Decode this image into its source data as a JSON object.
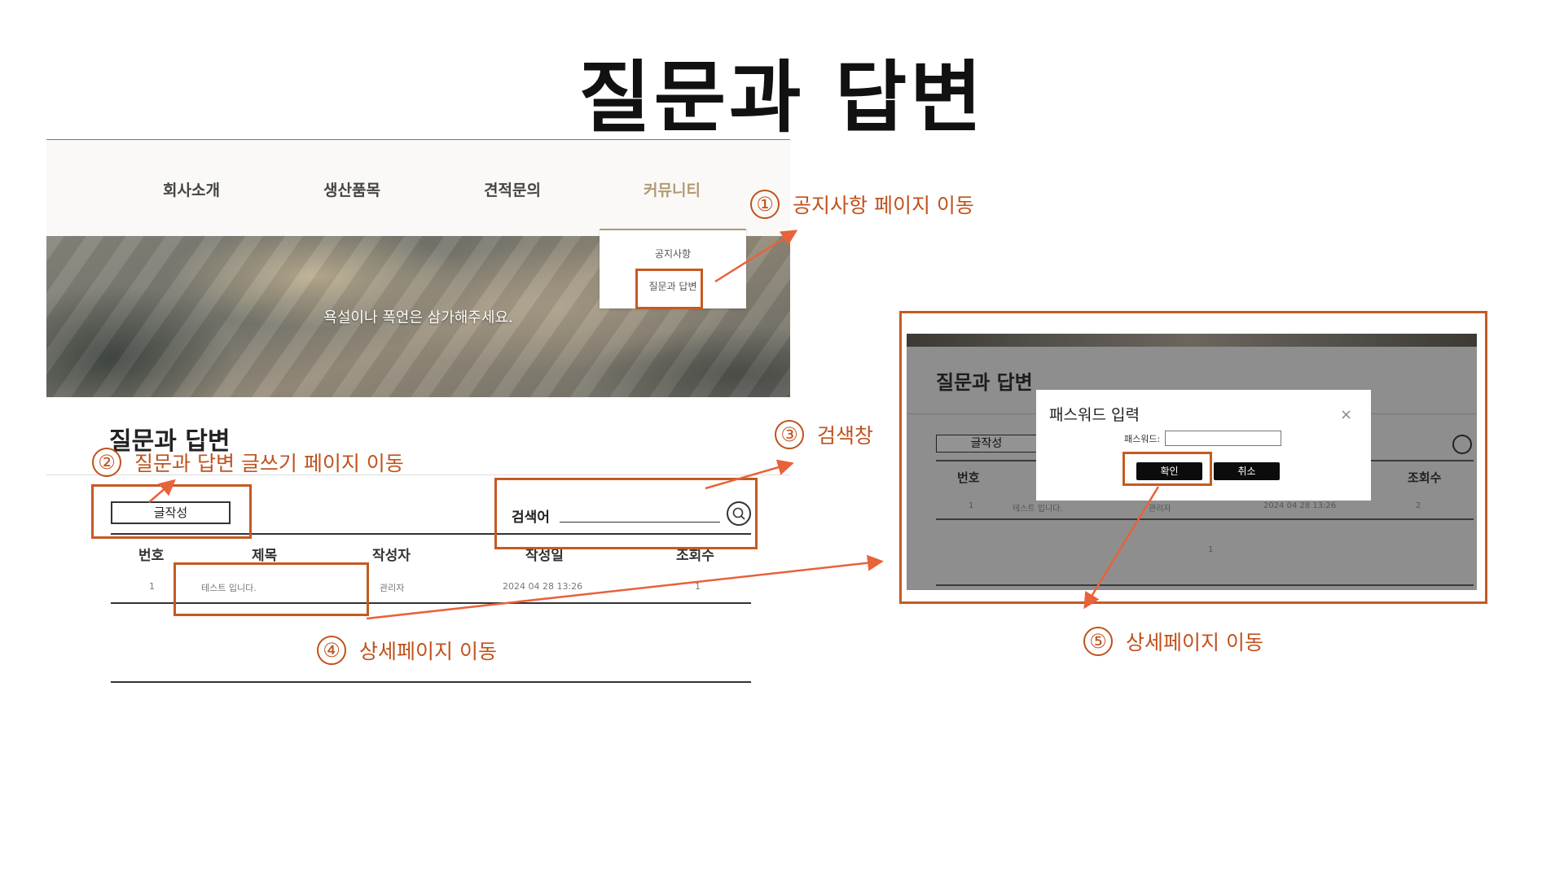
{
  "slide": {
    "title": "질문과 답변"
  },
  "site": {
    "nav": [
      "회사소개",
      "생산품목",
      "견적문의",
      "커뮤니티"
    ],
    "dropdown": [
      "공지사항",
      "질문과 답변"
    ],
    "hero_text": "욕설이나 폭언은 삼가해주세요.",
    "page_title": "질문과 답변",
    "write_button": "글작성",
    "search_label": "검색어",
    "table": {
      "headers": [
        "번호",
        "제목",
        "작성자",
        "작성일",
        "조회수"
      ],
      "rows": [
        {
          "no": "1",
          "title": "테스트 입니다.",
          "author": "관리자",
          "date": "2024 04 28 13:26",
          "views": "1"
        }
      ]
    }
  },
  "annotations": [
    {
      "num": "①",
      "text": "공지사항 페이지 이동"
    },
    {
      "num": "②",
      "text": "질문과 답변 글쓰기 페이지 이동"
    },
    {
      "num": "③",
      "text": "검색창"
    },
    {
      "num": "④",
      "text": "상세페이지 이동"
    },
    {
      "num": "⑤",
      "text": "상세페이지 이동"
    }
  ],
  "modal_shot": {
    "page_title": "질문과 답변",
    "write_button": "글작성",
    "header_no": "번호",
    "header_views": "조회수",
    "row": {
      "no": "1",
      "title": "테스트 입니다.",
      "author": "관리자",
      "date": "2024 04 28 13:26",
      "views": "2"
    },
    "pagination": "1",
    "modal": {
      "title": "패스워드 입력",
      "close": "×",
      "label": "패스워드:",
      "confirm": "확인",
      "cancel": "취소"
    }
  },
  "colors": {
    "accent": "#c55a22",
    "annotation_text": "#c0521c",
    "nav_active": "#b39a74"
  }
}
